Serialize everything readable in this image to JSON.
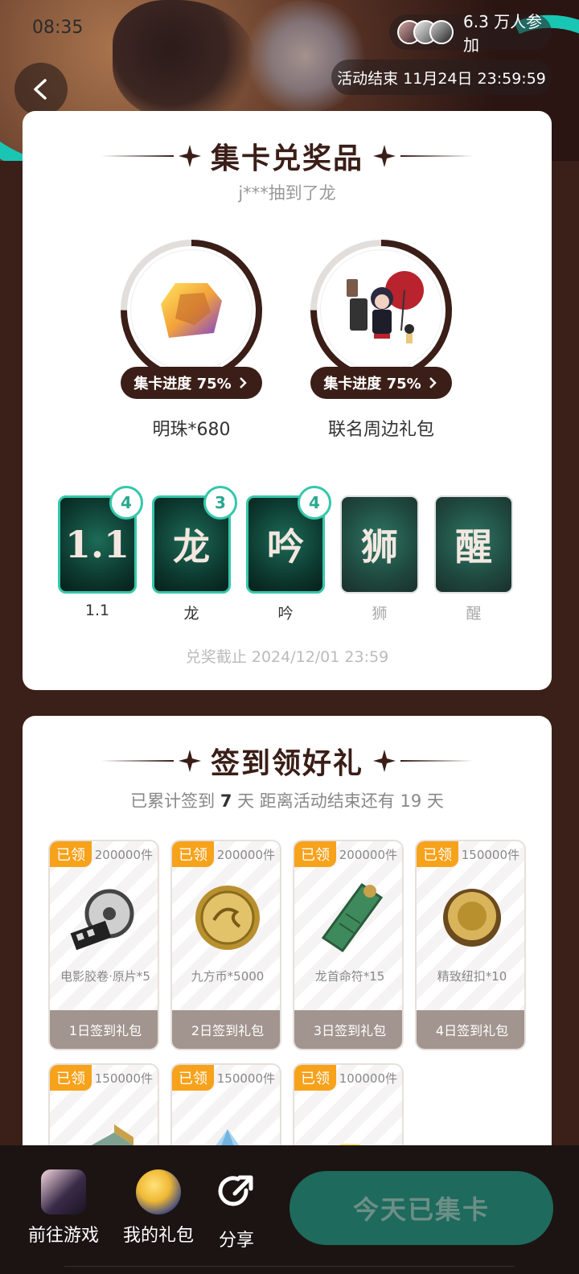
{
  "status": {
    "time": "08:35"
  },
  "header": {
    "participants": "6.3 万人参加",
    "end_time": "活动结束 11月24日 23:59:59"
  },
  "collect_section": {
    "title": "集卡兑奖品",
    "draw_info": "j***抽到了龙",
    "prizes": [
      {
        "name": "明珠*680",
        "progress_label": "集卡进度 75%",
        "progress": 0.75
      },
      {
        "name": "联名周边礼包",
        "progress_label": "集卡进度 75%",
        "progress": 0.75
      }
    ],
    "cards": [
      {
        "char": "1.1",
        "label": "1.1",
        "count": "4",
        "owned": true
      },
      {
        "char": "龙",
        "label": "龙",
        "count": "3",
        "owned": true
      },
      {
        "char": "吟",
        "label": "吟",
        "count": "4",
        "owned": true
      },
      {
        "char": "狮",
        "label": "狮",
        "count": "",
        "owned": false
      },
      {
        "char": "醒",
        "label": "醒",
        "count": "",
        "owned": false
      }
    ],
    "deadline": "兑奖截止 2024/12/01 23:59"
  },
  "checkin_section": {
    "title": "签到领好礼",
    "info_prefix": "已累计签到",
    "days": "7",
    "info_mid": "天  距离活动结束还有 19 天",
    "rewards": [
      {
        "tag": "已领",
        "stock": "200000件",
        "name": "电影胶卷·原片*5",
        "footer": "1日签到礼包",
        "icon": "film-reel-icon"
      },
      {
        "tag": "已领",
        "stock": "200000件",
        "name": "九方币*5000",
        "footer": "2日签到礼包",
        "icon": "gold-coin-icon"
      },
      {
        "tag": "已领",
        "stock": "200000件",
        "name": "龙首命符*15",
        "footer": "3日签到礼包",
        "icon": "jade-token-icon"
      },
      {
        "tag": "已领",
        "stock": "150000件",
        "name": "精致纽扣*10",
        "footer": "4日签到礼包",
        "icon": "button-icon"
      },
      {
        "tag": "已领",
        "stock": "150000件",
        "name": "",
        "footer": "",
        "icon": "book-icon"
      },
      {
        "tag": "已领",
        "stock": "150000件",
        "name": "",
        "footer": "",
        "icon": "crystal-icon"
      },
      {
        "tag": "已领",
        "stock": "100000件",
        "name": "",
        "footer": "",
        "icon": "gem-icon"
      }
    ]
  },
  "bottom_bar": {
    "go_game": "前往游戏",
    "my_gifts": "我的礼包",
    "share": "分享",
    "cta": "今天已集卡"
  }
}
